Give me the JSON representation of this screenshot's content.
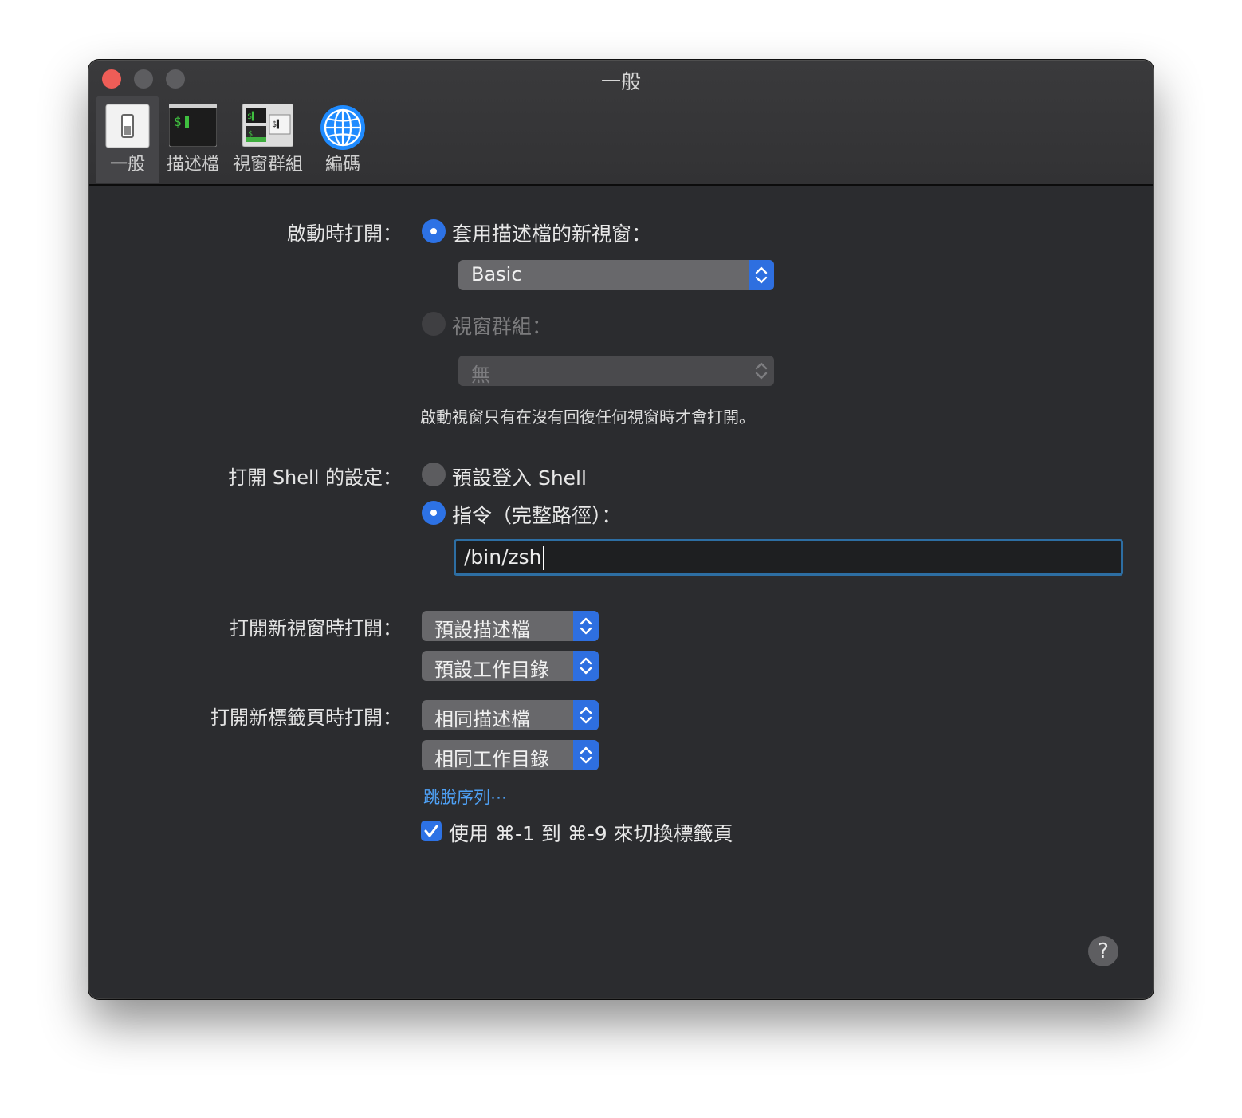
{
  "window": {
    "title": "一般"
  },
  "toolbar": {
    "items": [
      {
        "label": "一般",
        "icon": "general-switch-icon"
      },
      {
        "label": "描述檔",
        "icon": "terminal-profile-icon"
      },
      {
        "label": "視窗群組",
        "icon": "window-groups-icon"
      },
      {
        "label": "編碼",
        "icon": "globe-icon"
      }
    ]
  },
  "startup": {
    "label": "啟動時打開：",
    "option_profile": "套用描述檔的新視窗：",
    "profile_value": "Basic",
    "option_group": "視窗群組：",
    "group_value": "無",
    "hint": "啟動視窗只有在沒有回復任何視窗時才會打開。"
  },
  "shell": {
    "label": "打開 Shell 的設定：",
    "option_default": "預設登入 Shell",
    "option_command": "指令（完整路徑）：",
    "command_value": "/bin/zsh"
  },
  "new_window": {
    "label": "打開新視窗時打開：",
    "profile": "預設描述檔",
    "directory": "預設工作目錄"
  },
  "new_tab": {
    "label": "打開新標籤頁時打開：",
    "profile": "相同描述檔",
    "directory": "相同工作目錄"
  },
  "escape_link": "跳脫序列⋯",
  "tab_switch": {
    "label": "使用 ⌘-1 到 ⌘-9 來切換標籤頁",
    "checked": true
  },
  "help": "?",
  "colors": {
    "accent": "#2d72e5",
    "link": "#4ea0f4",
    "close": "#ee5d57"
  }
}
